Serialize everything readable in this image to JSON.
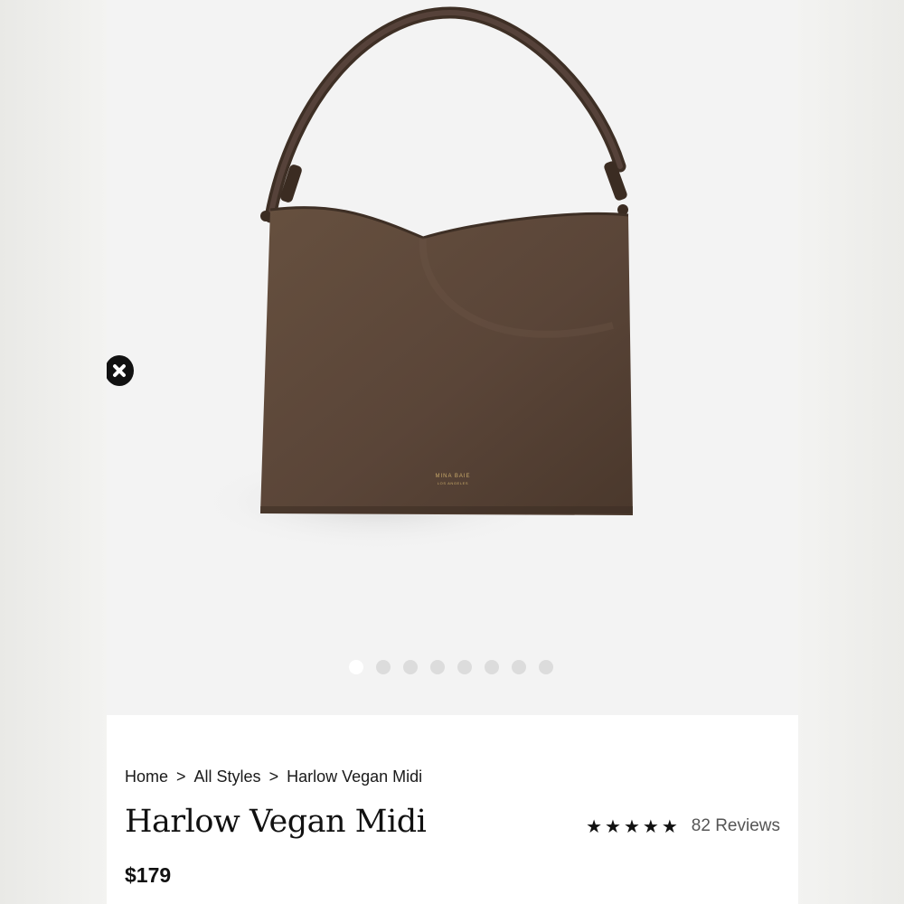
{
  "product": {
    "name": "Harlow Vegan Midi",
    "price": "$179",
    "brand_mark": "MINA BAIE",
    "brand_mark_sub": "LOS ANGELES",
    "bag_color": "#5a4538"
  },
  "breadcrumb": [
    {
      "label": "Home"
    },
    {
      "label": "All Styles"
    },
    {
      "label": "Harlow Vegan Midi"
    }
  ],
  "breadcrumb_separator": ">",
  "rating": {
    "value": 5,
    "max": 5,
    "stars": [
      "★",
      "★",
      "★",
      "★",
      "★"
    ],
    "reviews_label": "82 Reviews"
  },
  "gallery": {
    "image_count": 8,
    "active_index": 0
  },
  "icons": {
    "close": "close-icon",
    "star": "star-icon"
  }
}
